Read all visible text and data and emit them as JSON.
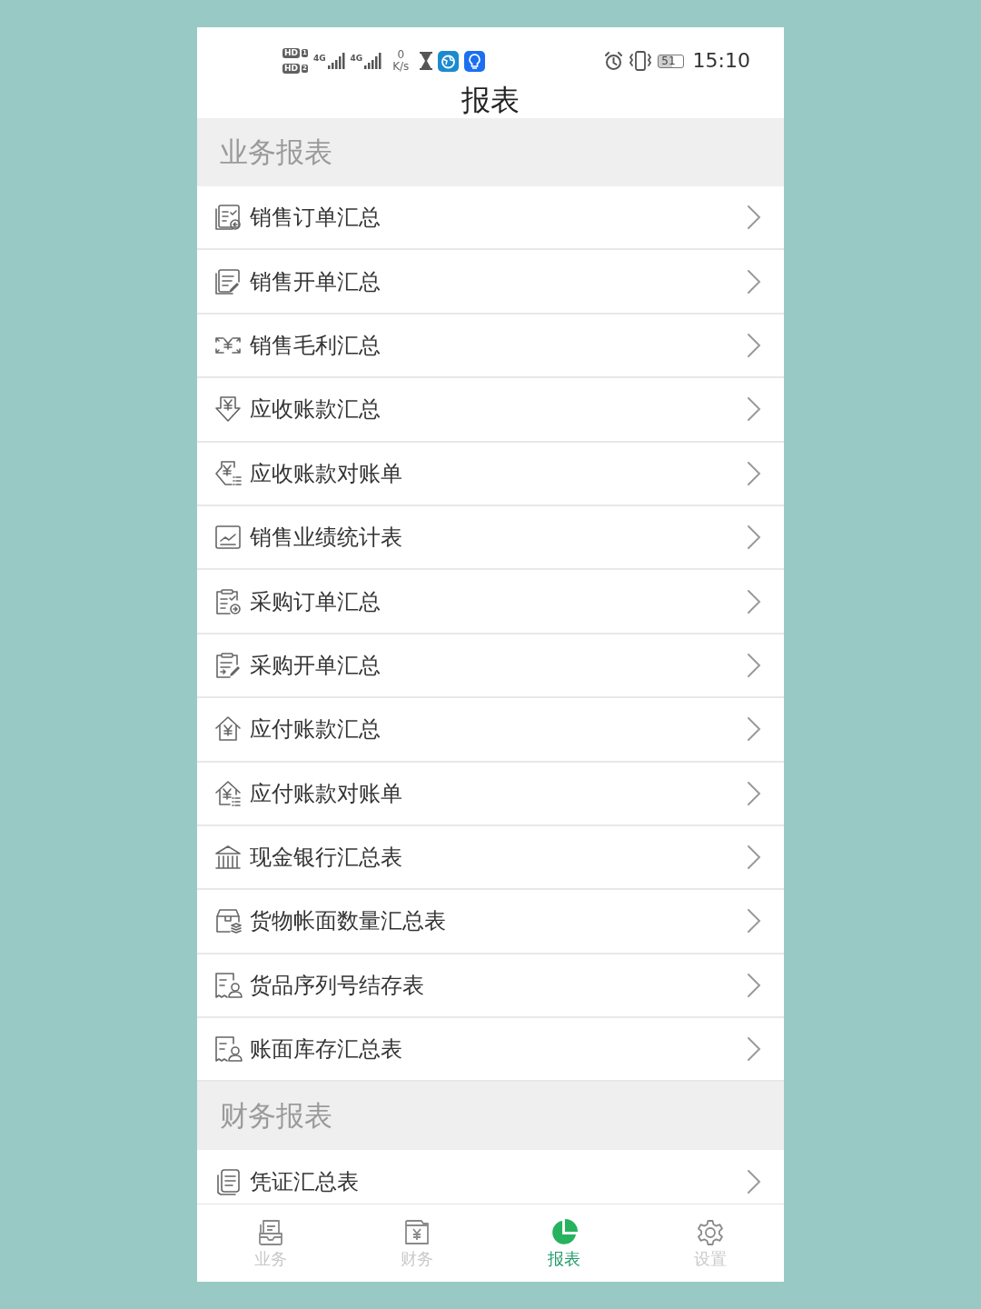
{
  "status_bar": {
    "sim_badges": [
      {
        "label": "HD",
        "slot": "1"
      },
      {
        "label": "HD",
        "slot": "2"
      }
    ],
    "networks": [
      "4G",
      "4G"
    ],
    "net_speed": {
      "value": "0",
      "unit": "K/s"
    },
    "battery": "51",
    "time": "15:10"
  },
  "header": {
    "title": "报表"
  },
  "sections": [
    {
      "title": "业务报表",
      "items": [
        {
          "label": "销售订单汇总"
        },
        {
          "label": "销售开单汇总"
        },
        {
          "label": "销售毛利汇总"
        },
        {
          "label": "应收账款汇总"
        },
        {
          "label": "应收账款对账单"
        },
        {
          "label": "销售业绩统计表"
        },
        {
          "label": "采购订单汇总"
        },
        {
          "label": "采购开单汇总"
        },
        {
          "label": "应付账款汇总"
        },
        {
          "label": "应付账款对账单"
        },
        {
          "label": "现金银行汇总表"
        },
        {
          "label": "货物帐面数量汇总表"
        },
        {
          "label": "货品序列号结存表"
        },
        {
          "label": "账面库存汇总表"
        }
      ]
    },
    {
      "title": "财务报表",
      "items": [
        {
          "label": "凭证汇总表"
        }
      ]
    }
  ],
  "tab_bar": [
    {
      "label": "业务",
      "selected": false
    },
    {
      "label": "财务",
      "selected": false
    },
    {
      "label": "报表",
      "selected": true
    },
    {
      "label": "设置",
      "selected": false
    }
  ]
}
